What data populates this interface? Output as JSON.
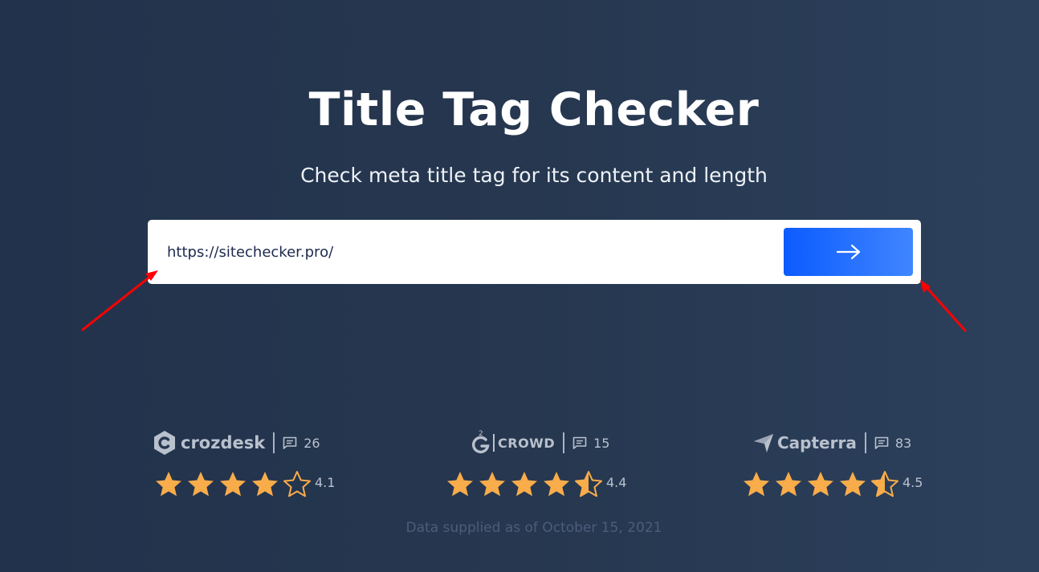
{
  "hero": {
    "title": "Title Tag Checker",
    "subtitle": "Check meta title tag for its content and length"
  },
  "search": {
    "url_value": "https://sitechecker.pro/",
    "submit_icon": "arrow-right-icon",
    "button_color_start": "#0c5bff",
    "button_color_end": "#3f86ff"
  },
  "annotations": {
    "arrow_color": "#ff0000"
  },
  "reviews": [
    {
      "platform": "crozdesk",
      "review_count": "26",
      "rating": "4.1",
      "rating_value": 4.1
    },
    {
      "platform": "CROWD",
      "platform_prefix": "2",
      "review_count": "15",
      "rating": "4.4",
      "rating_value": 4.4
    },
    {
      "platform": "Capterra",
      "review_count": "83",
      "rating": "4.5",
      "rating_value": 4.5
    }
  ],
  "icons": {
    "comment": "comment-icon",
    "star": "star-icon"
  },
  "colors": {
    "background_start": "#22324c",
    "background_end": "#2c405c",
    "star_fill": "#f9ac4a",
    "muted_text": "#b9c1cd"
  },
  "footer": {
    "data_note": "Data supplied as of October 15, 2021"
  }
}
